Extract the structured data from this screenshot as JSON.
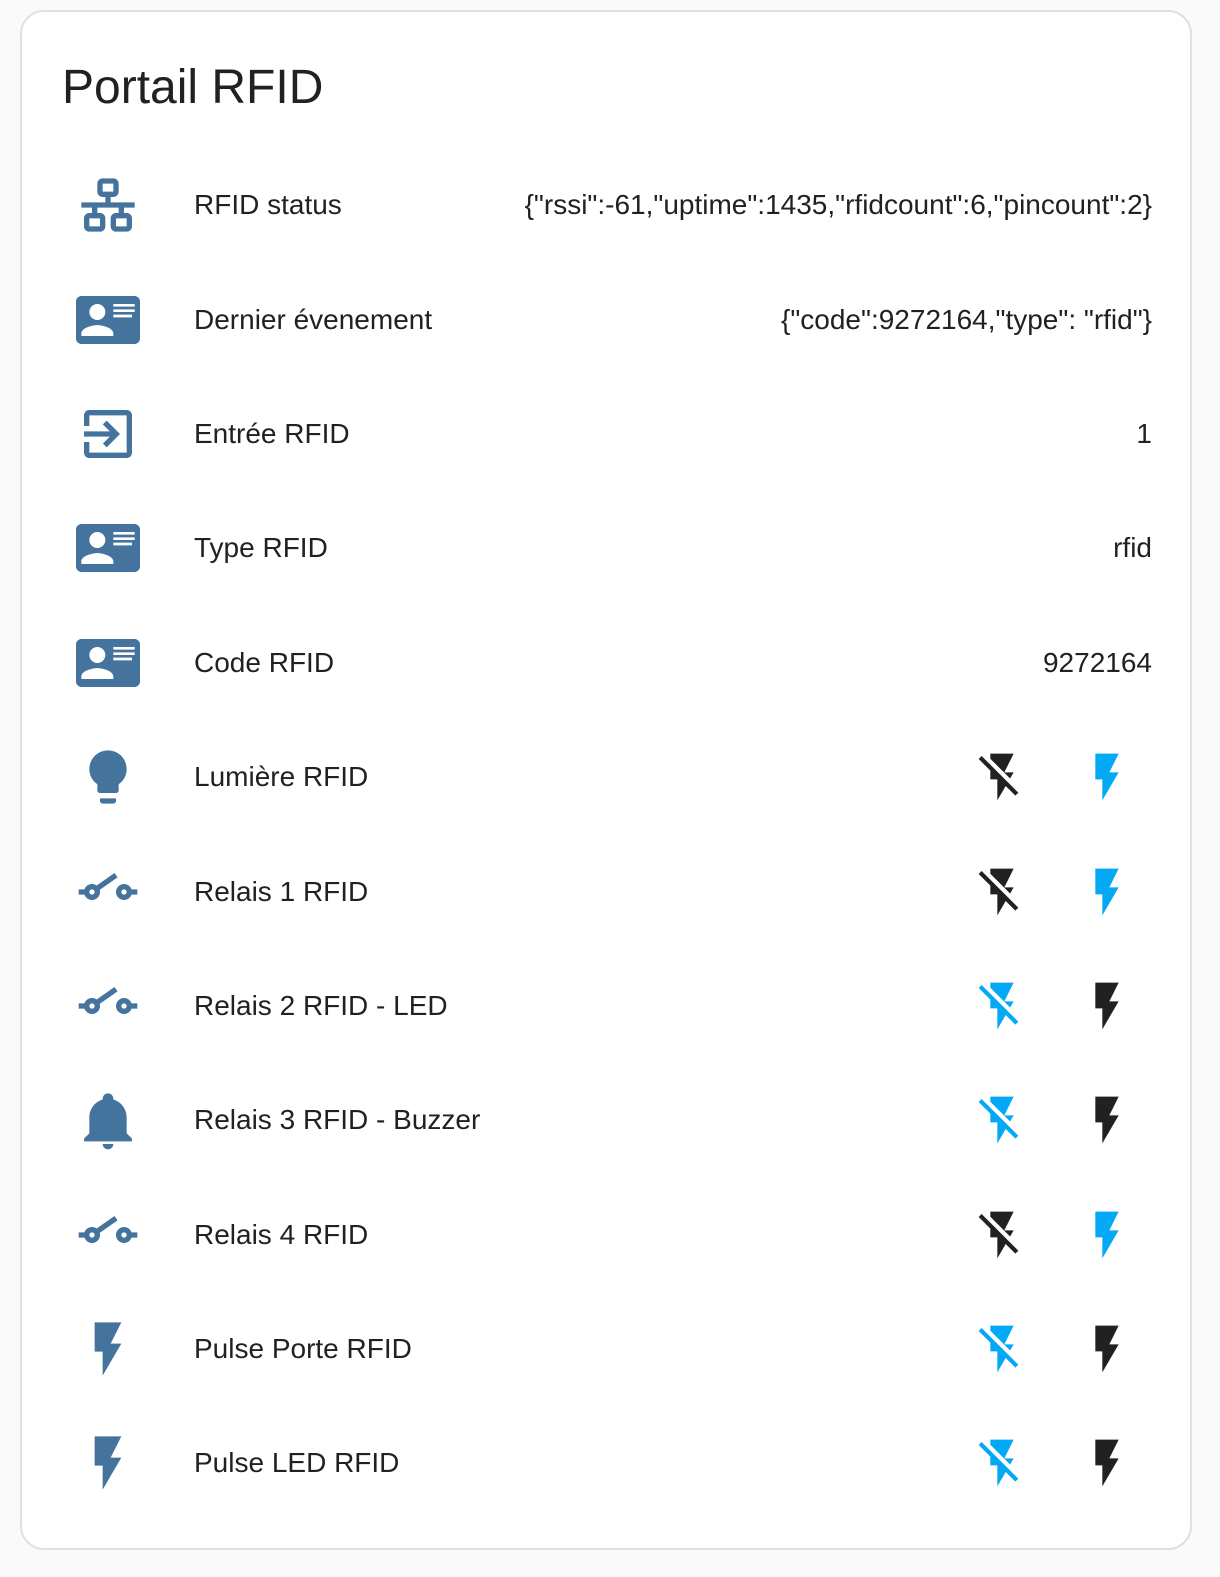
{
  "card": {
    "title": "Portail RFID"
  },
  "colors": {
    "state_icon": "#44739e",
    "active": "#03a9f4",
    "inactive": "#212121",
    "text": "#212121"
  },
  "rows": [
    {
      "label": "RFID status",
      "icon": "lan-icon",
      "value": "{\"rssi\":-61,\"uptime\":1435,\"rfidcount\":6,\"pincount\":2}"
    },
    {
      "label": "Dernier évenement",
      "icon": "card-account-details-icon",
      "value": "{\"code\":9272164,\"type\": \"rfid\"}"
    },
    {
      "label": "Entrée RFID",
      "icon": "import-icon",
      "value": "1"
    },
    {
      "label": "Type RFID",
      "icon": "card-account-details-icon",
      "value": "rfid"
    },
    {
      "label": "Code RFID",
      "icon": "card-account-details-icon",
      "value": "9272164"
    },
    {
      "label": "Lumière RFID",
      "icon": "lightbulb-icon",
      "state": "on"
    },
    {
      "label": "Relais 1 RFID",
      "icon": "electric-switch-icon",
      "state": "on"
    },
    {
      "label": "Relais 2 RFID - LED",
      "icon": "electric-switch-icon",
      "state": "off"
    },
    {
      "label": "Relais 3 RFID - Buzzer",
      "icon": "bell-icon",
      "state": "off"
    },
    {
      "label": "Relais 4 RFID",
      "icon": "electric-switch-icon",
      "state": "on"
    },
    {
      "label": "Pulse Porte RFID",
      "icon": "flash-icon",
      "state": "off"
    },
    {
      "label": "Pulse LED RFID",
      "icon": "flash-icon",
      "state": "off"
    }
  ]
}
